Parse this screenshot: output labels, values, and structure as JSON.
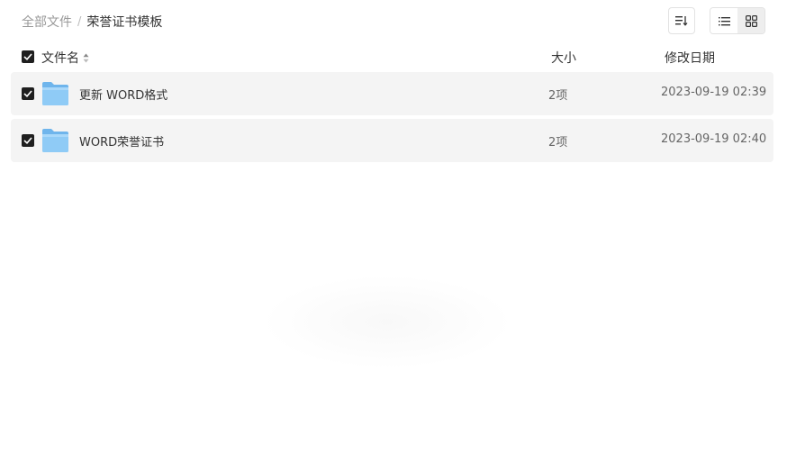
{
  "breadcrumb": {
    "root": "全部文件",
    "separator": "/",
    "current": "荣誉证书模板"
  },
  "toolbar": {
    "sort_icon": "sort-icon",
    "list_view_icon": "list-view-icon",
    "grid_view_icon": "grid-view-icon"
  },
  "header": {
    "name": "文件名",
    "size": "大小",
    "date": "修改日期"
  },
  "files": [
    {
      "name": "更新 WORD格式",
      "size": "2项",
      "date": "2023-09-19 02:39",
      "checked": true
    },
    {
      "name": "WORD荣誉证书",
      "size": "2项",
      "date": "2023-09-19 02:40",
      "checked": true
    }
  ],
  "colors": {
    "row_background": "#f4f4f4",
    "checkbox": "#1f1f1f",
    "folder": "#7cc0f2"
  }
}
